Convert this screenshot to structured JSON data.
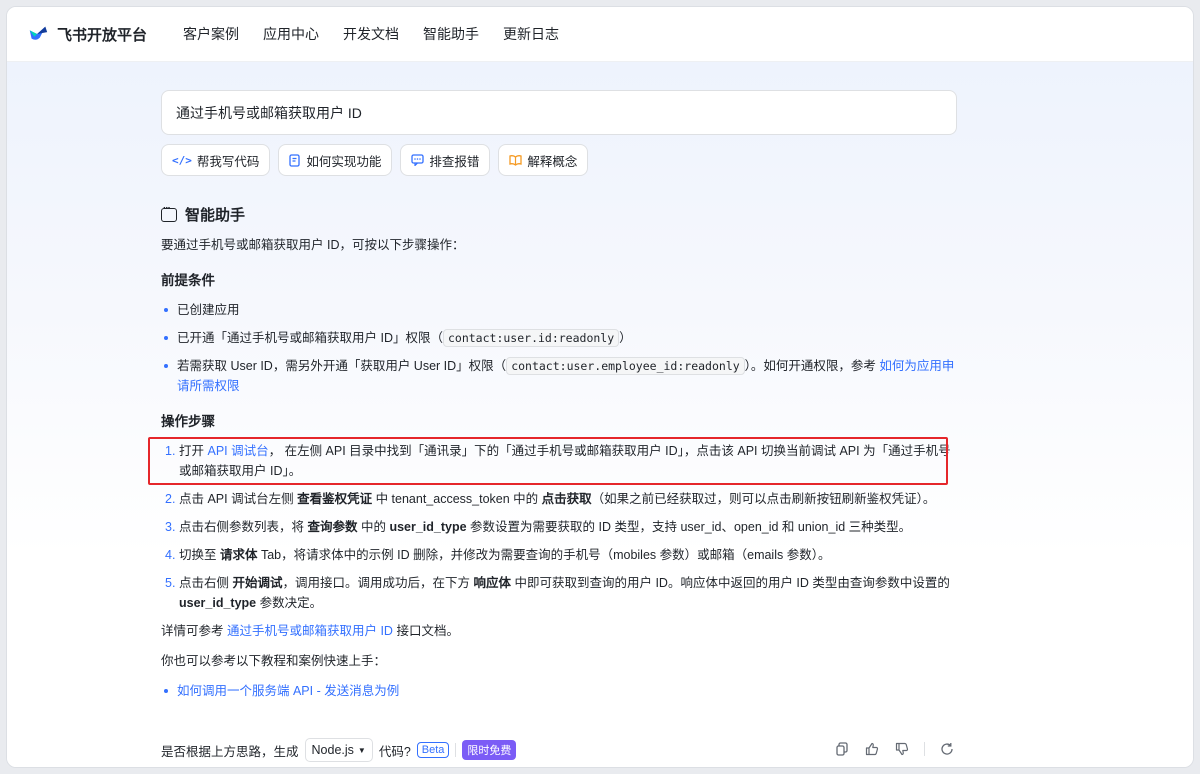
{
  "header": {
    "brand": "飞书开放平台",
    "nav": [
      "客户案例",
      "应用中心",
      "开发文档",
      "智能助手",
      "更新日志"
    ]
  },
  "query": "通过手机号或邮箱获取用户 ID",
  "chips": [
    {
      "icon": "code-icon",
      "label": "帮我写代码"
    },
    {
      "icon": "document-icon",
      "label": "如何实现功能"
    },
    {
      "icon": "chat-icon",
      "label": "排查报错"
    },
    {
      "icon": "book-icon",
      "label": "解释概念"
    }
  ],
  "assistant": {
    "title": "智能助手",
    "intro": "要通过手机号或邮箱获取用户 ID，可按以下步骤操作：",
    "prereq_title": "前提条件",
    "prereqs": {
      "p1": "已创建应用",
      "p2_a": "已开通「通过手机号或邮箱获取用户 ID」权限（",
      "p2_code": "contact:user.id:readonly",
      "p2_b": "）",
      "p3_a": "若需获取 User ID，需另外开通「获取用户 User ID」权限（",
      "p3_code": "contact:user.employee_id:readonly",
      "p3_b": "）。如何开通权限，参考 ",
      "p3_link": "如何为应用申请所需权限"
    },
    "steps_title": "操作步骤",
    "steps": {
      "s1_num": "1.",
      "s1_a": "打开 ",
      "s1_link": "API 调试台",
      "s1_b": "， 在左侧 API 目录中找到「通讯录」下的「通过手机号或邮箱获取用户 ID」，点击该 API 切换当前调试 API 为「通过手机号或邮箱获取用户 ID」。",
      "s2_num": "2.",
      "s2_a": "点击 API 调试台左侧 ",
      "s2_b1": "查看鉴权凭证",
      "s2_b": " 中 tenant_access_token 中的 ",
      "s2_b2": "点击获取",
      "s2_c": "（如果之前已经获取过，则可以点击刷新按钮刷新鉴权凭证）。",
      "s3_num": "3.",
      "s3_a": "点击右侧参数列表，将 ",
      "s3_b1": "查询参数",
      "s3_b": " 中的 ",
      "s3_b2": "user_id_type",
      "s3_c": " 参数设置为需要获取的 ID 类型，支持 user_id、open_id 和 union_id 三种类型。",
      "s4_num": "4.",
      "s4_a": "切换至 ",
      "s4_b1": "请求体",
      "s4_b": " Tab，将请求体中的示例 ID 删除，并修改为需要查询的手机号（mobiles 参数）或邮箱（emails 参数）。",
      "s5_num": "5.",
      "s5_a": "点击右侧 ",
      "s5_b1": "开始调试",
      "s5_b": "，调用接口。调用成功后，在下方 ",
      "s5_b2": "响应体",
      "s5_c": " 中即可获取到查询的用户 ID。响应体中返回的用户 ID 类型由查询参数中设置的 ",
      "s5_b3": "user_id_type",
      "s5_d": " 参数决定。"
    },
    "more_a": "详情可参考 ",
    "more_link": "通过手机号或邮箱获取用户 ID",
    "more_b": " 接口文档。",
    "also": "你也可以参考以下教程和案例快速上手：",
    "tutorial_link": "如何调用一个服务端 API - 发送消息为例"
  },
  "footer": {
    "prompt": "是否根据上方思路，生成",
    "language": "Node.js",
    "suffix": "代码?",
    "beta": "Beta",
    "free": "限时免费"
  },
  "actions": [
    "copy-icon",
    "thumbs-up-icon",
    "thumbs-down-icon",
    "refresh-icon"
  ]
}
